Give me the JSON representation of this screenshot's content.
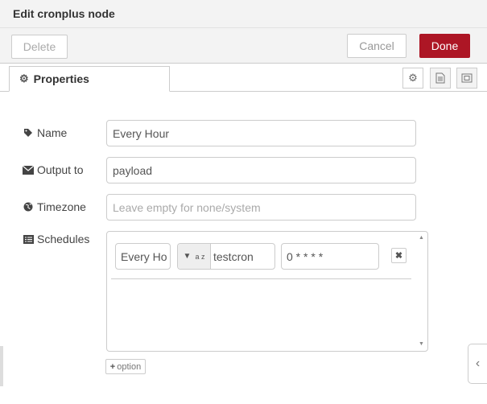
{
  "header": {
    "title": "Edit cronplus node"
  },
  "toolbar": {
    "delete_label": "Delete",
    "cancel_label": "Cancel",
    "done_label": "Done"
  },
  "tabs": {
    "properties_label": "Properties"
  },
  "form": {
    "name_label": "Name",
    "name_value": "Every Hour",
    "output_label": "Output to",
    "output_value": "payload",
    "timezone_label": "Timezone",
    "timezone_placeholder": "Leave empty for none/system",
    "schedules_label": "Schedules"
  },
  "schedules": [
    {
      "name": "Every Ho",
      "type_badge": "a z",
      "type_value": "testcron",
      "cron": "0 * * * *"
    }
  ],
  "add_option_label": "option",
  "colors": {
    "accent": "#ad1625",
    "header_bg": "#f3f3f3",
    "border": "#cccccc"
  }
}
